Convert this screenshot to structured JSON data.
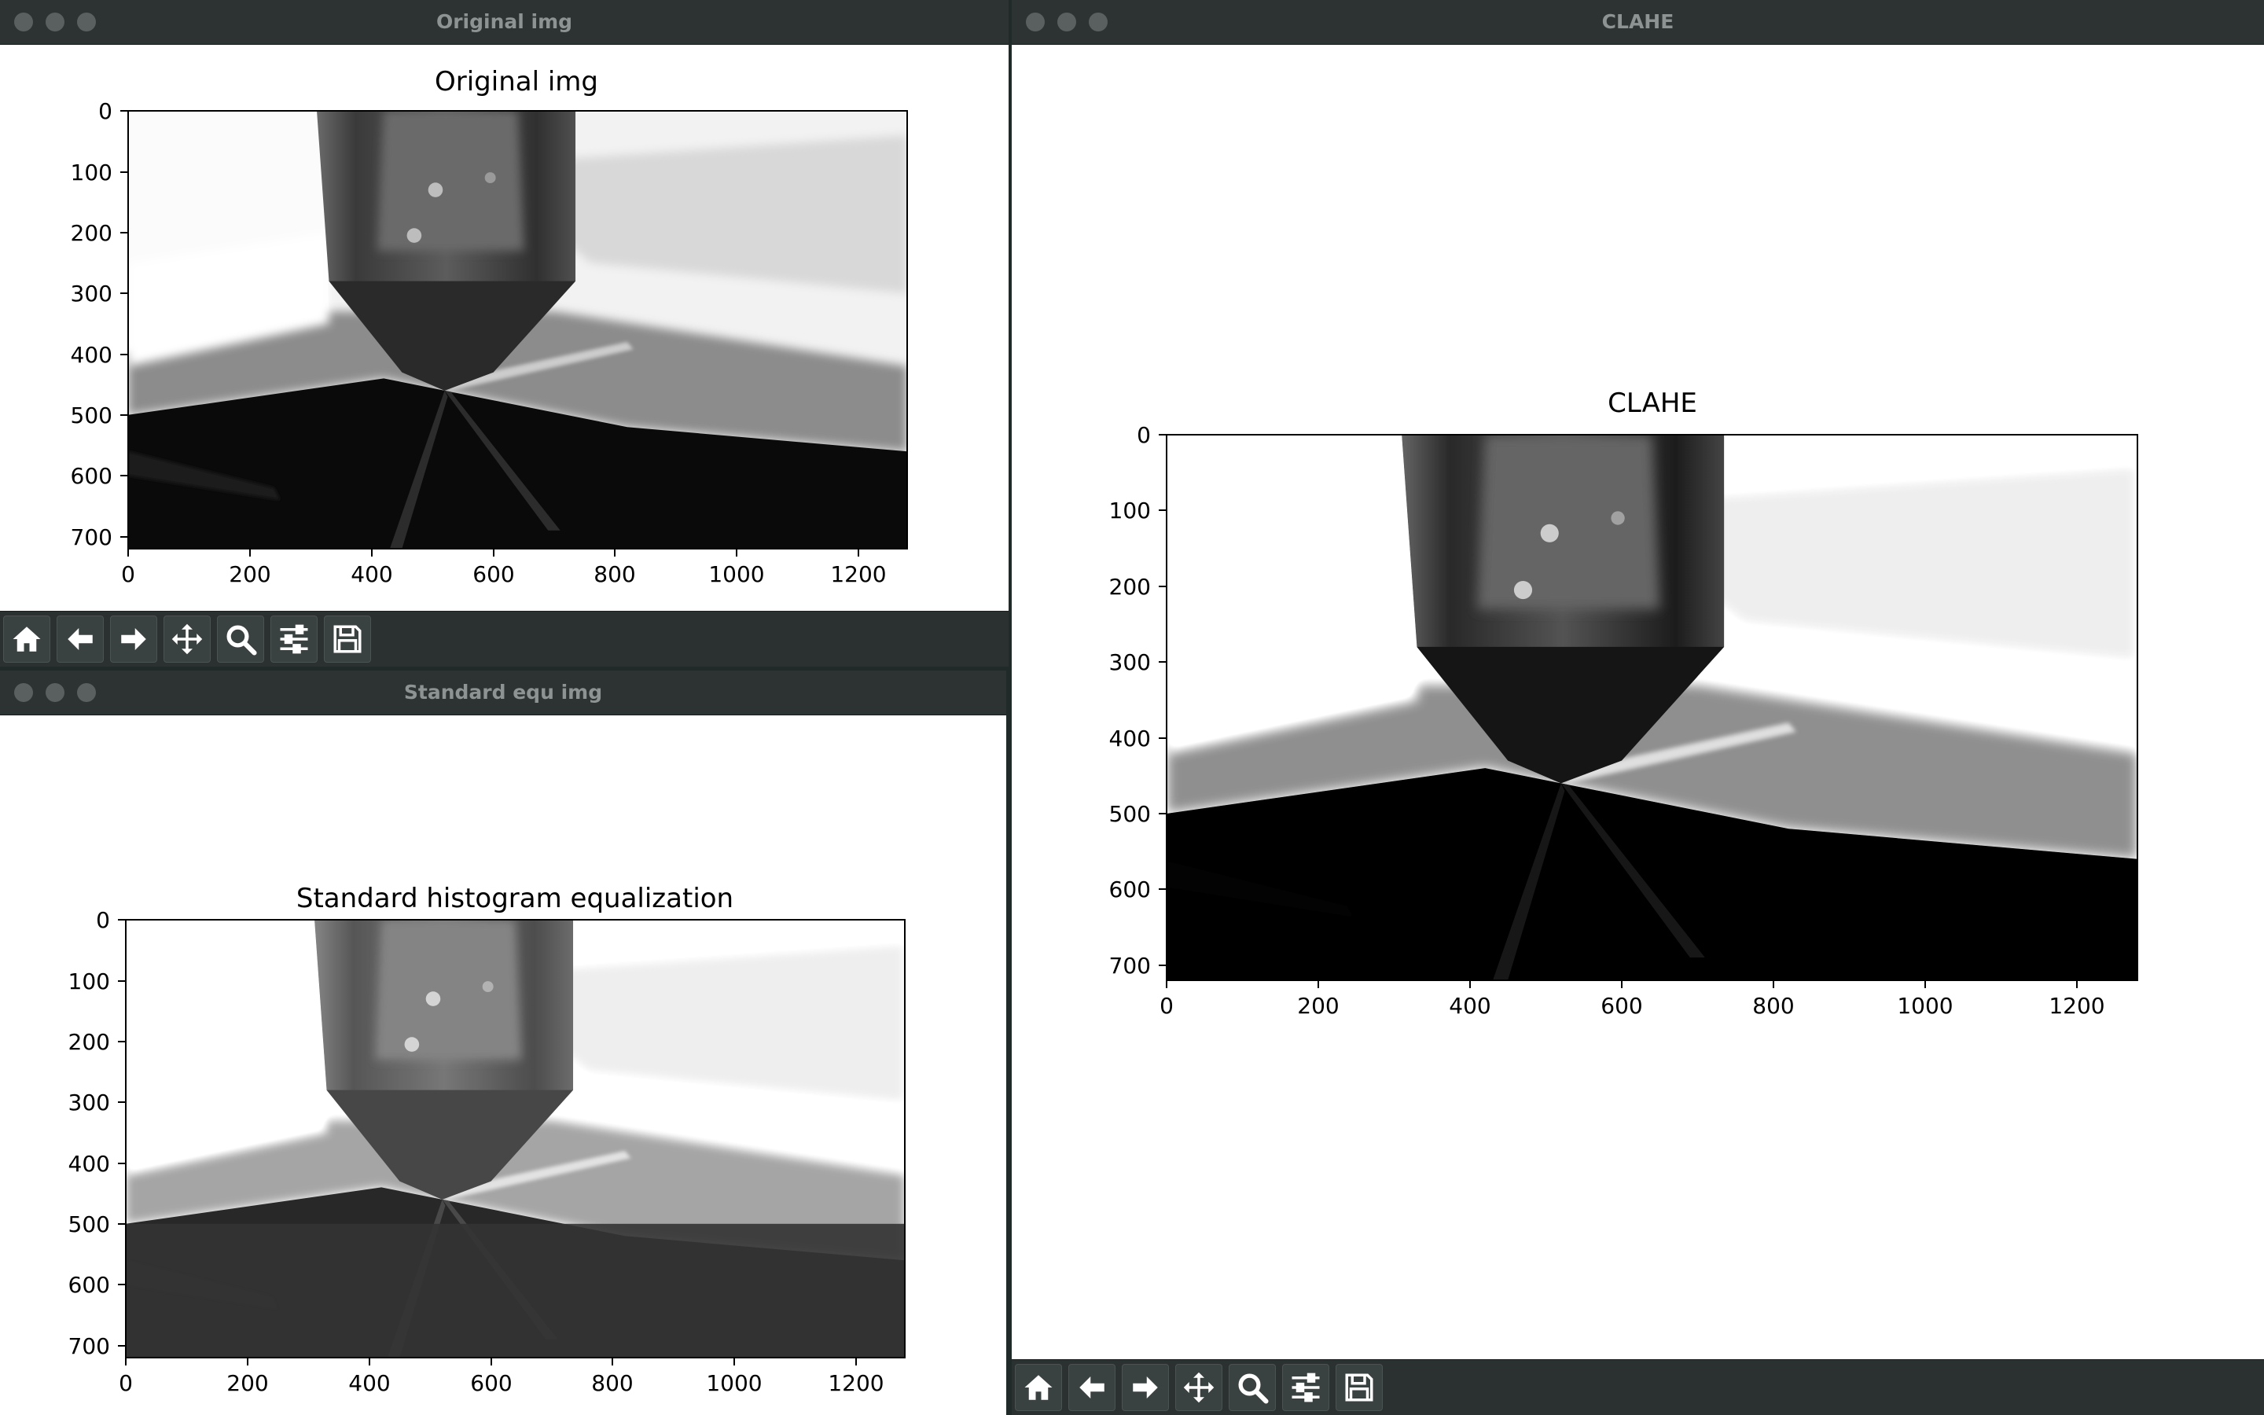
{
  "windows": {
    "original": {
      "title": "Original img",
      "plot_title": "Original img"
    },
    "standard": {
      "title": "Standard equ img",
      "plot_title": "Standard histogram equalization"
    },
    "clahe": {
      "title": "CLAHE",
      "plot_title": "CLAHE"
    }
  },
  "axes": {
    "x_ticks": [
      "0",
      "200",
      "400",
      "600",
      "800",
      "1000",
      "1200"
    ],
    "y_ticks": [
      "0",
      "100",
      "200",
      "300",
      "400",
      "500",
      "600",
      "700"
    ]
  },
  "toolbar": {
    "buttons": [
      {
        "icon": "home-icon"
      },
      {
        "icon": "back-arrow-icon"
      },
      {
        "icon": "forward-arrow-icon"
      },
      {
        "icon": "pan-move-icon"
      },
      {
        "icon": "zoom-magnifier-icon"
      },
      {
        "icon": "configure-sliders-icon"
      },
      {
        "icon": "save-disk-icon"
      }
    ]
  },
  "colors": {
    "window_bg": "#ffffff",
    "titlebar": "#2d3333",
    "toolbar": "#2b3131",
    "desktop": "#1f2a29"
  }
}
